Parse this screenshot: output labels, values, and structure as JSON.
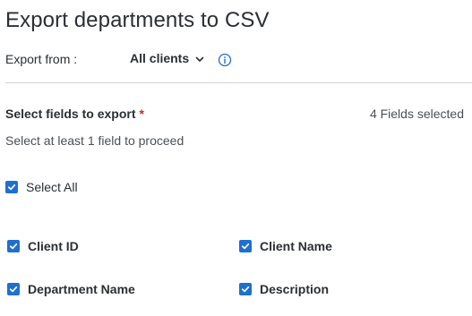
{
  "page": {
    "title": "Export departments to CSV"
  },
  "export": {
    "label": "Export from :",
    "selected_client": "All clients",
    "icons": {
      "dropdown": "chevron-down-icon",
      "info": "info-icon"
    }
  },
  "fields": {
    "title": "Select fields to export",
    "required_marker": "*",
    "count_text": "4 Fields selected",
    "hint": "Select at least 1 field to proceed",
    "select_all": {
      "label": "Select All",
      "checked": true
    },
    "items": [
      {
        "label": "Client ID",
        "checked": true
      },
      {
        "label": "Client Name",
        "checked": true
      },
      {
        "label": "Department Name",
        "checked": true
      },
      {
        "label": "Description",
        "checked": true
      }
    ]
  },
  "colors": {
    "checkbox": "#1f6fd1",
    "required": "#d0262a",
    "info_icon": "#1f6fd1",
    "divider": "#cfd3d7"
  }
}
